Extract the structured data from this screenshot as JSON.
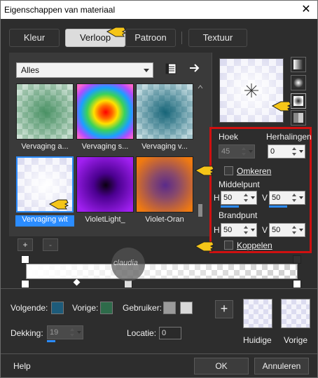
{
  "window": {
    "title": "Eigenschappen van materiaal",
    "close_glyph": "✕"
  },
  "tabs": [
    {
      "label": "Kleur",
      "active": false
    },
    {
      "label": "Verloop",
      "active": true
    },
    {
      "label": "Patroon",
      "active": false
    },
    {
      "label": "Textuur",
      "active": false
    }
  ],
  "gallery": {
    "category": "Alles",
    "items": [
      {
        "label": "Vervaging a...",
        "selected": false,
        "icon": "green-checker-gradient"
      },
      {
        "label": "Vervaging s...",
        "selected": false,
        "icon": "rainbow-radial-gradient"
      },
      {
        "label": "Vervaging v...",
        "selected": false,
        "icon": "teal-checker-gradient"
      },
      {
        "label": "Vervaging wit",
        "selected": true,
        "icon": "white-purple-checker-gradient"
      },
      {
        "label": "VioletLight_",
        "selected": false,
        "icon": "violet-radial-gradient"
      },
      {
        "label": "Violet-Oran",
        "selected": false,
        "icon": "violet-orange-radial-gradient"
      }
    ],
    "add_button": "+",
    "remove_button": "-"
  },
  "settings": {
    "hoek_label": "Hoek",
    "hoek_value": "45",
    "herhalingen_label": "Herhalingen",
    "herhalingen_value": "0",
    "omkeren_label": "Omkeren",
    "middelpunt_label": "Middelpunt",
    "middelpunt_h_label": "H",
    "middelpunt_h_value": "50",
    "middelpunt_v_label": "V",
    "middelpunt_v_value": "50",
    "brandpunt_label": "Brandpunt",
    "brandpunt_h_label": "H",
    "brandpunt_h_value": "50",
    "brandpunt_v_label": "V",
    "brandpunt_v_value": "50",
    "koppelen_label": "Koppelen"
  },
  "stops": {
    "volgende_label": "Volgende:",
    "vorige_label": "Vorige:",
    "gebruiker_label": "Gebruiker:",
    "dekking_label": "Dekking:",
    "dekking_value": "19",
    "locatie_label": "Locatie:",
    "locatie_value": "0",
    "add_button": "+"
  },
  "recent": {
    "huidige_label": "Huidige",
    "vorige_label": "Vorige"
  },
  "footer": {
    "help_label": "Help",
    "ok_label": "OK",
    "cancel_label": "Annuleren"
  },
  "watermark": {
    "text": "claudia"
  },
  "colors": {
    "accent": "#2b8cff",
    "highlight_frame": "#d01010",
    "pointer": "#f5c518"
  }
}
